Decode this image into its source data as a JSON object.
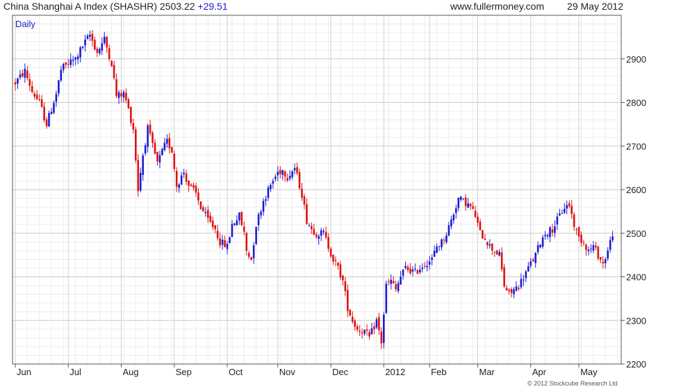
{
  "header": {
    "name": "China Shanghai A Index (SHASHR)",
    "last": "2503.22",
    "change": "+29.51",
    "site": "www.fullermoney.com",
    "date": "29 May 2012"
  },
  "copyright": "© 2012 Stockcube Research Ltd",
  "colors": {
    "up": "#1a1ad6",
    "down": "#e01010",
    "grid": "#d9d9d9",
    "frame": "#555555",
    "period_label": "#1a1ad6"
  },
  "chart_data": {
    "type": "candlestick",
    "period_label": "Daily",
    "ylim": [
      2200,
      3000
    ],
    "y_ticks": [
      2200,
      2300,
      2400,
      2500,
      2600,
      2700,
      2800,
      2900
    ],
    "x_month_labels": [
      "Jun",
      "Jul",
      "Aug",
      "Sep",
      "Oct",
      "Nov",
      "Dec",
      "2012",
      "Feb",
      "Mar",
      "Apr",
      "May"
    ],
    "x_month_label_days": [
      0,
      22,
      44,
      66,
      88,
      109,
      131,
      153,
      172,
      192,
      214,
      234
    ],
    "grid": true,
    "y_axis_side": "right",
    "close_path": [
      [
        0,
        2845
      ],
      [
        4,
        2872
      ],
      [
        7,
        2825
      ],
      [
        10,
        2800
      ],
      [
        13,
        2750
      ],
      [
        17,
        2820
      ],
      [
        19,
        2875
      ],
      [
        22,
        2890
      ],
      [
        25,
        2900
      ],
      [
        28,
        2930
      ],
      [
        31,
        2955
      ],
      [
        34,
        2915
      ],
      [
        37,
        2945
      ],
      [
        40,
        2890
      ],
      [
        42,
        2815
      ],
      [
        45,
        2820
      ],
      [
        46,
        2805
      ],
      [
        49,
        2740
      ],
      [
        51,
        2600
      ],
      [
        53,
        2680
      ],
      [
        55,
        2740
      ],
      [
        57,
        2700
      ],
      [
        59,
        2660
      ],
      [
        62,
        2700
      ],
      [
        63,
        2710
      ],
      [
        65,
        2690
      ],
      [
        67,
        2610
      ],
      [
        70,
        2640
      ],
      [
        72,
        2610
      ],
      [
        75,
        2590
      ],
      [
        77,
        2560
      ],
      [
        80,
        2530
      ],
      [
        83,
        2510
      ],
      [
        85,
        2480
      ],
      [
        88,
        2470
      ],
      [
        90,
        2520
      ],
      [
        93,
        2540
      ],
      [
        95,
        2500
      ],
      [
        96,
        2460
      ],
      [
        98,
        2440
      ],
      [
        100,
        2520
      ],
      [
        103,
        2575
      ],
      [
        106,
        2610
      ],
      [
        109,
        2640
      ],
      [
        111,
        2645
      ],
      [
        113,
        2630
      ],
      [
        116,
        2650
      ],
      [
        119,
        2590
      ],
      [
        121,
        2530
      ],
      [
        123,
        2510
      ],
      [
        125,
        2500
      ],
      [
        128,
        2500
      ],
      [
        130,
        2470
      ],
      [
        132,
        2440
      ],
      [
        134,
        2420
      ],
      [
        136,
        2390
      ],
      [
        138,
        2330
      ],
      [
        140,
        2300
      ],
      [
        142,
        2280
      ],
      [
        145,
        2275
      ],
      [
        147,
        2260
      ],
      [
        150,
        2300
      ],
      [
        152,
        2250
      ],
      [
        154,
        2380
      ],
      [
        156,
        2390
      ],
      [
        158,
        2370
      ],
      [
        160,
        2400
      ],
      [
        162,
        2420
      ],
      [
        166,
        2410
      ],
      [
        168,
        2420
      ],
      [
        170,
        2430
      ],
      [
        173,
        2440
      ],
      [
        175,
        2470
      ],
      [
        177,
        2480
      ],
      [
        179,
        2500
      ],
      [
        181,
        2530
      ],
      [
        184,
        2580
      ],
      [
        187,
        2570
      ],
      [
        189,
        2560
      ],
      [
        191,
        2540
      ],
      [
        193,
        2500
      ],
      [
        195,
        2490
      ],
      [
        197,
        2470
      ],
      [
        199,
        2460
      ],
      [
        201,
        2450
      ],
      [
        203,
        2380
      ],
      [
        205,
        2360
      ],
      [
        207,
        2370
      ],
      [
        209,
        2380
      ],
      [
        211,
        2400
      ],
      [
        213,
        2420
      ],
      [
        216,
        2450
      ],
      [
        218,
        2480
      ],
      [
        220,
        2500
      ],
      [
        223,
        2510
      ],
      [
        226,
        2540
      ],
      [
        228,
        2560
      ],
      [
        230,
        2565
      ],
      [
        232,
        2520
      ],
      [
        234,
        2490
      ],
      [
        236,
        2480
      ],
      [
        238,
        2460
      ],
      [
        240,
        2470
      ],
      [
        242,
        2450
      ],
      [
        244,
        2430
      ],
      [
        246,
        2460
      ],
      [
        248,
        2500
      ]
    ]
  }
}
